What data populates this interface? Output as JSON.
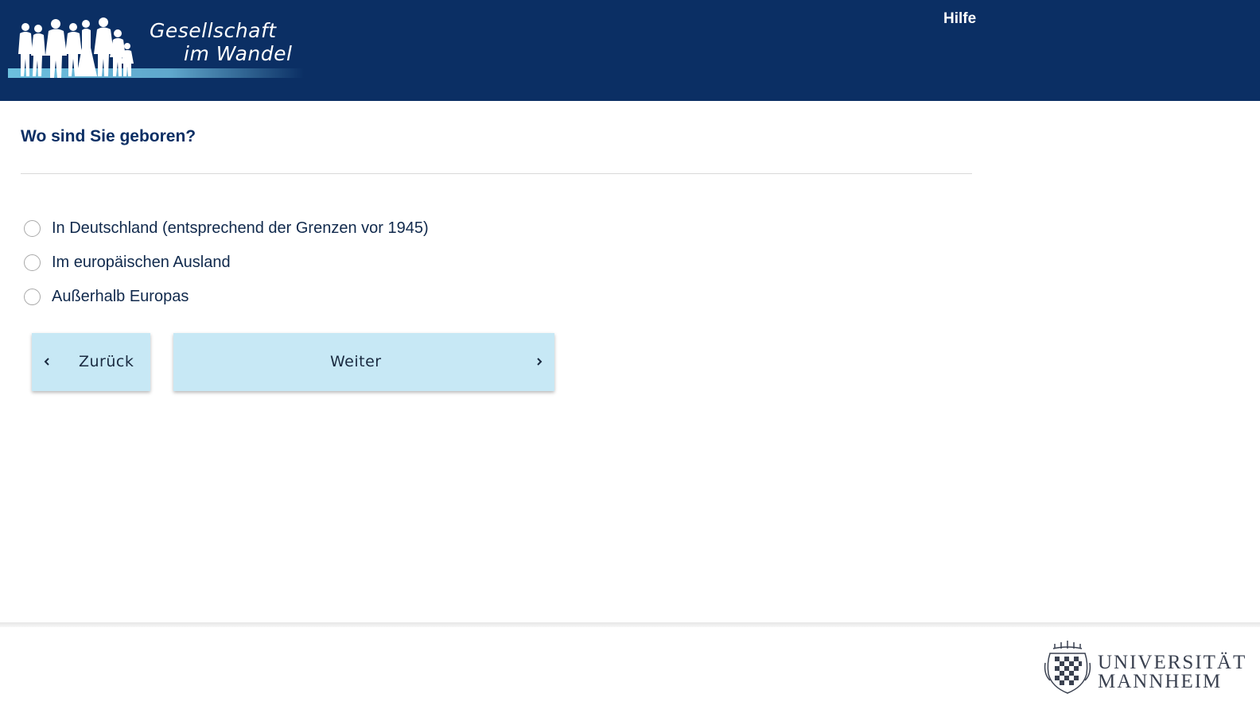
{
  "header": {
    "logo": {
      "line1": "Gesellschaft",
      "line2": "im Wandel",
      "icon": "family-silhouette-logo"
    },
    "help_label": "Hilfe"
  },
  "question": {
    "title": "Wo sind Sie geboren?",
    "options": [
      {
        "label": "In Deutschland (entsprechend der Grenzen vor 1945)",
        "selected": false
      },
      {
        "label": "Im europäischen Ausland",
        "selected": false
      },
      {
        "label": "Außerhalb Europas",
        "selected": false
      }
    ]
  },
  "navigation": {
    "back_label": "Zurück",
    "next_label": "Weiter"
  },
  "footer": {
    "university_line1": "UNIVERSITÄT",
    "university_line2": "MANNHEIM",
    "icon": "university-crest-logo"
  },
  "colors": {
    "header_bg": "#0b2f64",
    "button_bg": "#c7e8f5",
    "title_text": "#0b2f64"
  }
}
